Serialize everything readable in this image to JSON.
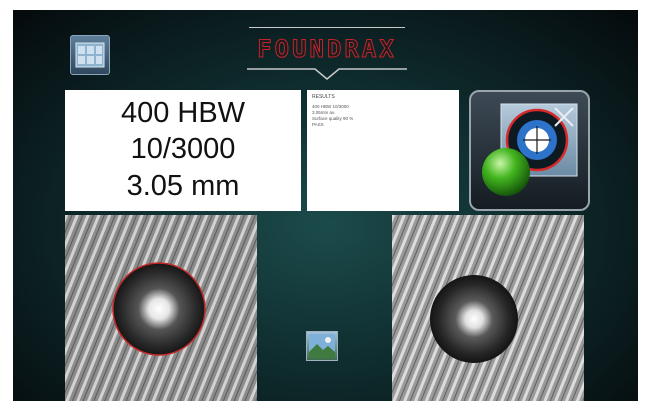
{
  "brand": {
    "name": "FOUNDRAX"
  },
  "result": {
    "line1": "400 HBW",
    "line2": "10/3000",
    "line3": "3.05 mm"
  },
  "details": {
    "title": "RESULTS",
    "lines": [
      "400 HBW 10/3000",
      "3.05mm av.",
      "Surface quality 90 %",
      "PASS"
    ]
  },
  "icons": {
    "menu": "window-grid-icon",
    "measure": "measure-target-icon",
    "status": "green-ball-icon",
    "image": "landscape-image-icon"
  },
  "colors": {
    "brand_red": "#c4232e",
    "indicator_green": "#43b51f",
    "background": "#0f2d2f"
  }
}
